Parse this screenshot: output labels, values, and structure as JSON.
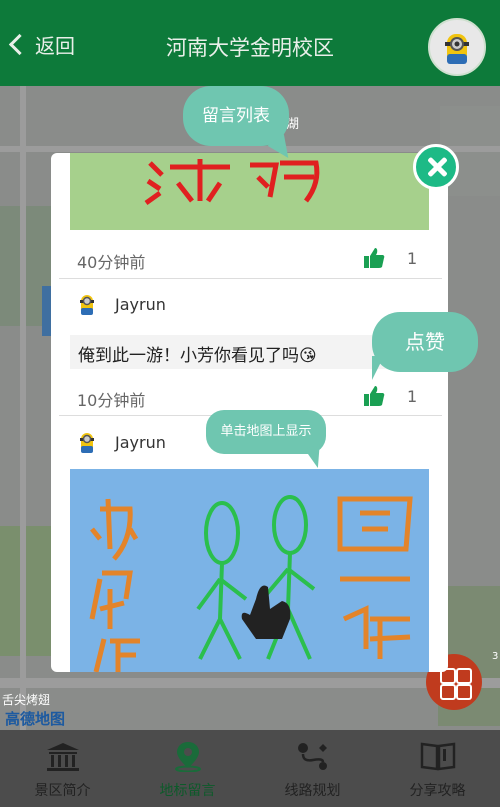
{
  "header": {
    "back_label": "返回",
    "title": "河南大学金明校区"
  },
  "map": {
    "labels": {
      "lake": "湖",
      "bbq": "舌尖烤翅",
      "logo": "高德地图",
      "edge": "3"
    }
  },
  "modal": {
    "comments": [
      {
        "time": "40分钟前",
        "likes": "1",
        "image_text": "涂鸦"
      },
      {
        "user": "Jayrun",
        "message": "俺到此一游！小芳你看见了吗😘",
        "time": "10分钟前",
        "likes": "1"
      },
      {
        "user": "Jayrun",
        "image_text": "为你作 画一幅"
      }
    ]
  },
  "tooltips": {
    "list": "留言列表",
    "like": "点赞",
    "map_show": "单击地图上显示"
  },
  "tabs": [
    {
      "label": "景区简介"
    },
    {
      "label": "地标留言"
    },
    {
      "label": "线路规划"
    },
    {
      "label": "分享攻略"
    }
  ],
  "colors": {
    "header_bg": "#0d7a3a",
    "accent": "#1dba86",
    "like": "#1aa053",
    "fab": "#c03b1e"
  }
}
